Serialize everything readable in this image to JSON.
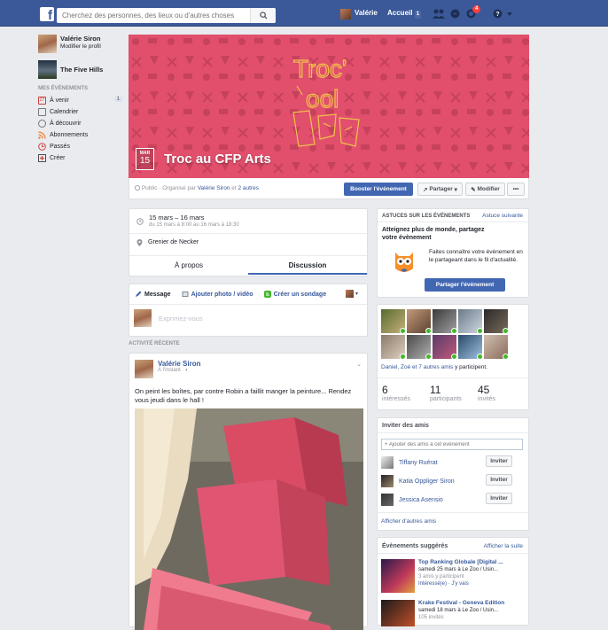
{
  "topbar": {
    "search_placeholder": "Cherchez des personnes, des lieux ou d'autres choses",
    "user_name": "Valérie",
    "home_label": "Accueil",
    "home_count": "1",
    "notif_count": "4"
  },
  "sidebar": {
    "profile_name": "Valérie Siron",
    "profile_sub": "Modifier le profil",
    "page_name": "The Five Hills",
    "section_title": "MES ÉVÉNEMENTS",
    "items": [
      {
        "label": "À venir",
        "count": "1"
      },
      {
        "label": "Calendrier"
      },
      {
        "label": "À découvrir"
      },
      {
        "label": "Abonnements"
      },
      {
        "label": "Passés"
      },
      {
        "label": "Créer"
      }
    ],
    "date_icon_day": "27"
  },
  "event": {
    "cover_logo_line1": "Troc'",
    "cover_logo_line2": "ool",
    "date_month": "MAR",
    "date_day": "15",
    "title": "Troc au CFP Arts",
    "meta_prefix": "Public · Organisé par ",
    "meta_organizer": "Valérie Siron",
    "meta_middle": " et ",
    "meta_others": "2 autres",
    "boost_label": "Booster l'événement",
    "share_label": "Partager",
    "edit_label": "Modifier",
    "more_label": "•••"
  },
  "details": {
    "date_main": "15 mars – 16 mars",
    "date_sub": "du 15 mars à 8:00 au 16 mars à 18:30",
    "location": "Grenier de Necker",
    "tab_about": "À propos",
    "tab_discussion": "Discussion"
  },
  "composer": {
    "message": "Message",
    "photo": "Ajouter photo / vidéo",
    "poll": "Créer un sondage",
    "placeholder": "Exprimez-vous"
  },
  "activity": {
    "title": "ACTIVITÉ RÉCENTE",
    "post_author": "Valérie Siron",
    "post_time": "À l'instant · ",
    "post_text": "On peint les boîtes, par contre Robin a faillit manger la peinture... Rendez vous jeudi dans le hall !"
  },
  "tips": {
    "header": "ASTUCES SUR LES ÉVÉNEMENTS",
    "next": "Astuce suivante",
    "title": "Atteignez plus de monde, partagez votre évènement",
    "body": "Faites connaître votre évènement en le partageant dans le fil d'actualité.",
    "button": "Partager l'événement"
  },
  "attendees": {
    "names_prefix": "Daniel, Zoé et ",
    "names_link": "7 autres amis",
    "names_suffix": " y participent.",
    "stats": [
      {
        "num": "6",
        "label": "intéressés"
      },
      {
        "num": "11",
        "label": "participants"
      },
      {
        "num": "45",
        "label": "invités"
      }
    ]
  },
  "invite": {
    "title": "Inviter des amis",
    "placeholder": "+ Ajouter des amis à cet événement",
    "friends": [
      {
        "name": "Tiffany Ruérat",
        "button": "Inviter"
      },
      {
        "name": "Katia Oppliger Siron",
        "button": "Inviter"
      },
      {
        "name": "Jessica Asensio",
        "button": "Inviter"
      }
    ],
    "more": "Afficher d'autres amis"
  },
  "suggested": {
    "title": "Évènements suggérés",
    "more": "Afficher la suite",
    "events": [
      {
        "name": "Top Ranking Globale [Digital ...",
        "when": "samedi 25 mars à Le Zoo / Usin...",
        "friends": "3 amis y participent",
        "actions": "Intéressé(e) · J'y vais"
      },
      {
        "name": "Krake Festival - Geneva Edition",
        "when": "samedi 18 mars à Le Zoo / Usin...",
        "friends": "105 invités",
        "actions": ""
      }
    ]
  },
  "colors": {
    "brand": "#3b5998",
    "cover": "#e14f6c",
    "logo_gold": "#f0c24b",
    "button_blue": "#4267b2"
  }
}
